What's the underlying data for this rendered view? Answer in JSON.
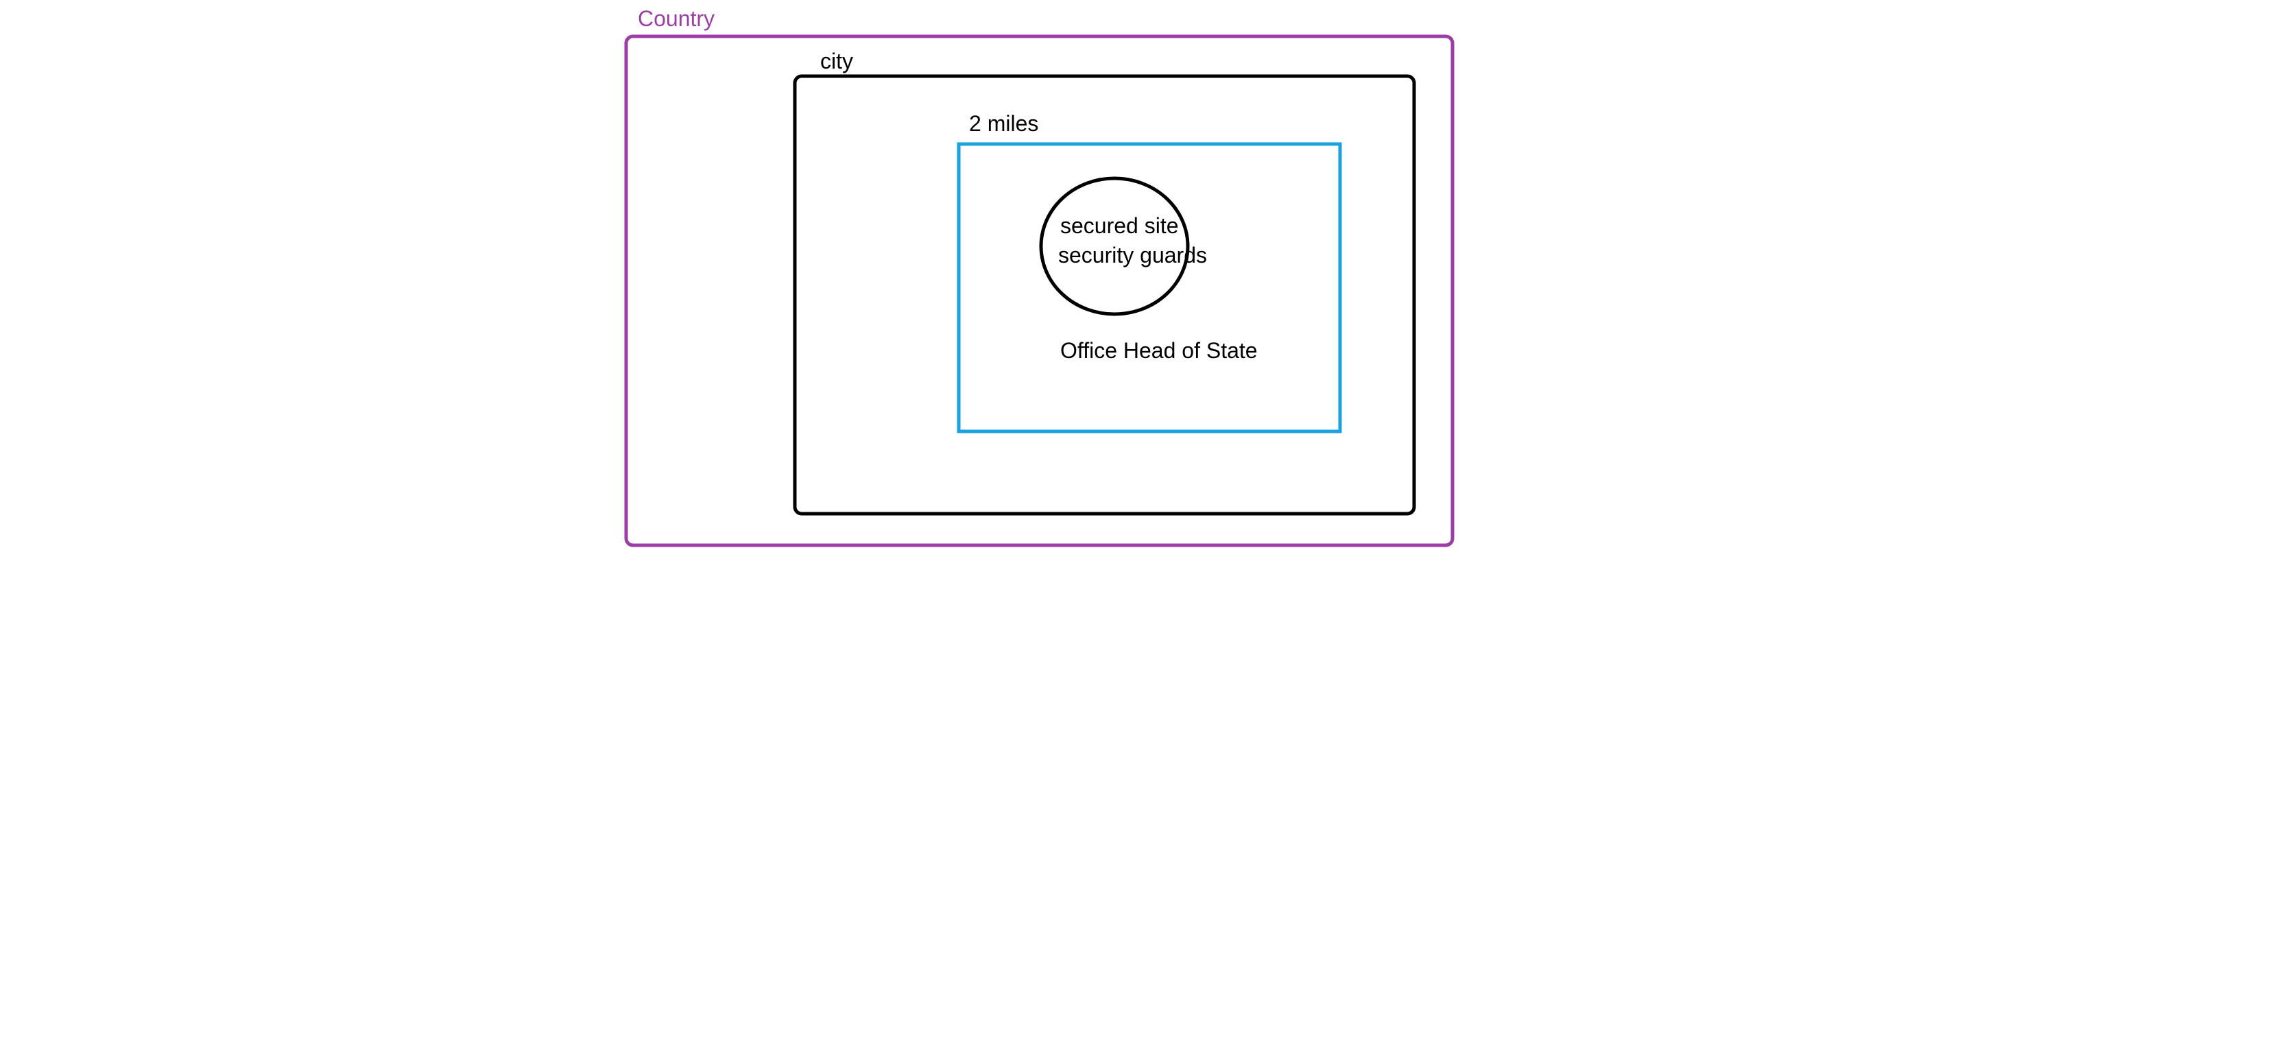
{
  "diagram": {
    "country": {
      "label": "Country",
      "color": "#9B3FA6"
    },
    "city": {
      "label": "city",
      "color": "#000000"
    },
    "zone": {
      "label": "2 miles",
      "color": "#1AA3DF"
    },
    "site": {
      "line1": "secured site",
      "line2": "security guards",
      "color": "#000000"
    },
    "office": {
      "label": "Office Head of State"
    }
  }
}
